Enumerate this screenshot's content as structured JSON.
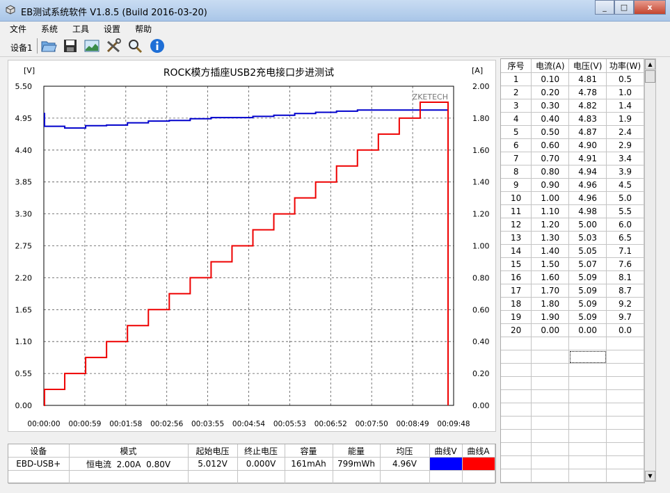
{
  "window": {
    "title": "EB测试系统软件 V1.8.5 (Build 2016-03-20)",
    "buttons": [
      "_",
      "□",
      "x"
    ]
  },
  "menu": [
    "文件",
    "系统",
    "工具",
    "设置",
    "帮助"
  ],
  "toolbar": {
    "device_label": "设备1",
    "icons": [
      "folder-open-icon",
      "save-icon",
      "chart-image-icon",
      "tools-icon",
      "zoom-icon",
      "info-icon"
    ]
  },
  "chart_data": {
    "type": "line",
    "title": "ROCK模方插座USB2充电接口步进测试",
    "left_unit": "[V]",
    "right_unit": "[A]",
    "watermark": "ZKETECH",
    "yleft_ticks": [
      "5.50",
      "4.95",
      "4.40",
      "3.85",
      "3.30",
      "2.75",
      "2.20",
      "1.65",
      "1.10",
      "0.55",
      "0.00"
    ],
    "yright_ticks": [
      "2.00",
      "1.80",
      "1.60",
      "1.40",
      "1.20",
      "1.00",
      "0.80",
      "0.60",
      "0.40",
      "0.20",
      "0.00"
    ],
    "x_ticks": [
      "00:00:00",
      "00:00:59",
      "00:01:58",
      "00:02:56",
      "00:03:55",
      "00:04:54",
      "00:05:53",
      "00:06:52",
      "00:07:50",
      "00:08:49",
      "00:09:48"
    ],
    "yleft_range": [
      0,
      5.5
    ],
    "yright_range": [
      0,
      2.0
    ],
    "x_range_seconds": [
      0,
      588
    ],
    "grid": true,
    "series": [
      {
        "name": "曲线V",
        "axis": "left",
        "color": "#0000cc",
        "x_seconds": [
          0,
          1,
          30,
          60,
          90,
          120,
          150,
          180,
          210,
          240,
          270,
          300,
          330,
          360,
          390,
          420,
          450,
          480,
          510,
          540,
          570,
          580
        ],
        "values": [
          5.03,
          4.81,
          4.78,
          4.82,
          4.83,
          4.87,
          4.9,
          4.91,
          4.94,
          4.96,
          4.96,
          4.98,
          5.0,
          5.03,
          5.05,
          5.07,
          5.09,
          5.09,
          5.09,
          5.09,
          5.09,
          5.09
        ]
      },
      {
        "name": "曲线A",
        "axis": "right",
        "color": "#ee0000",
        "x_seconds": [
          0,
          1,
          30,
          60,
          90,
          120,
          150,
          180,
          210,
          240,
          270,
          300,
          330,
          360,
          390,
          420,
          450,
          480,
          510,
          540,
          570,
          580
        ],
        "values": [
          0.0,
          0.1,
          0.2,
          0.3,
          0.4,
          0.5,
          0.6,
          0.7,
          0.8,
          0.9,
          1.0,
          1.1,
          1.2,
          1.3,
          1.4,
          1.5,
          1.6,
          1.7,
          1.8,
          1.9,
          1.9,
          0.0
        ]
      }
    ]
  },
  "data_table": {
    "headers": [
      "序号",
      "电流(A)",
      "电压(V)",
      "功率(W)"
    ],
    "rows": [
      [
        "1",
        "0.10",
        "4.81",
        "0.5"
      ],
      [
        "2",
        "0.20",
        "4.78",
        "1.0"
      ],
      [
        "3",
        "0.30",
        "4.82",
        "1.4"
      ],
      [
        "4",
        "0.40",
        "4.83",
        "1.9"
      ],
      [
        "5",
        "0.50",
        "4.87",
        "2.4"
      ],
      [
        "6",
        "0.60",
        "4.90",
        "2.9"
      ],
      [
        "7",
        "0.70",
        "4.91",
        "3.4"
      ],
      [
        "8",
        "0.80",
        "4.94",
        "3.9"
      ],
      [
        "9",
        "0.90",
        "4.96",
        "4.5"
      ],
      [
        "10",
        "1.00",
        "4.96",
        "5.0"
      ],
      [
        "11",
        "1.10",
        "4.98",
        "5.5"
      ],
      [
        "12",
        "1.20",
        "5.00",
        "6.0"
      ],
      [
        "13",
        "1.30",
        "5.03",
        "6.5"
      ],
      [
        "14",
        "1.40",
        "5.05",
        "7.1"
      ],
      [
        "15",
        "1.50",
        "5.07",
        "7.6"
      ],
      [
        "16",
        "1.60",
        "5.09",
        "8.1"
      ],
      [
        "17",
        "1.70",
        "5.09",
        "8.7"
      ],
      [
        "18",
        "1.80",
        "5.09",
        "9.2"
      ],
      [
        "19",
        "1.90",
        "5.09",
        "9.7"
      ],
      [
        "20",
        "0.00",
        "0.00",
        "0.0"
      ]
    ],
    "selected_cell": "row 22, column 电压(V)"
  },
  "summary_table": {
    "headers": [
      "设备",
      "模式",
      "起始电压",
      "终止电压",
      "容量",
      "能量",
      "均压",
      "曲线V",
      "曲线A"
    ],
    "row": {
      "device": "EBD-USB+",
      "mode": "恒电流  2.00A  0.80V",
      "start_voltage": "5.012V",
      "end_voltage": "0.000V",
      "capacity": "161mAh",
      "energy": "799mWh",
      "avg_voltage": "4.96V",
      "curve_v_color": "#0000ff",
      "curve_a_color": "#ff0000"
    }
  }
}
